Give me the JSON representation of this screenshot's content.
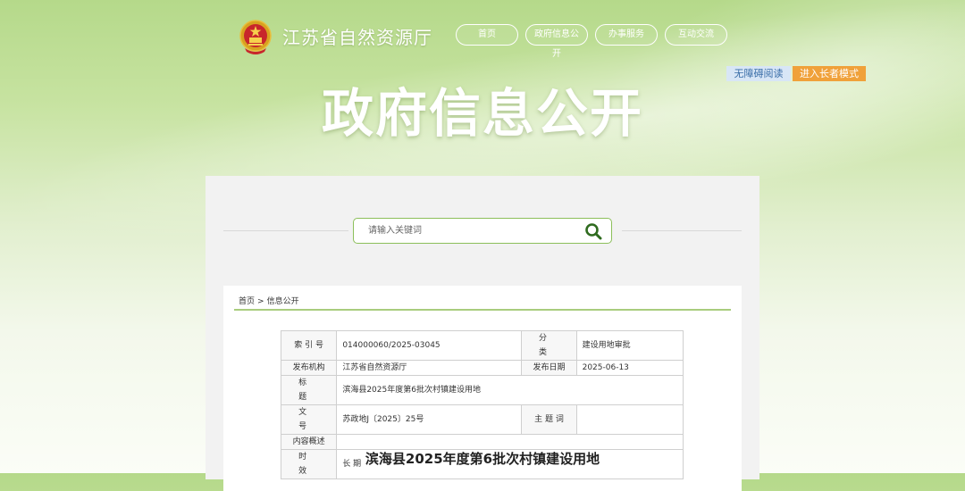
{
  "header": {
    "site_title": "江苏省自然资源厅",
    "nav": [
      "首页",
      "政府信息公开",
      "办事服务",
      "互动交流"
    ],
    "accessibility_label": "无障碍阅读",
    "elder_mode_label": "进入长者模式",
    "hero_title": "政府信息公开"
  },
  "search": {
    "placeholder": "请输入关键词"
  },
  "breadcrumb": {
    "items": [
      "首页",
      "信息公开"
    ],
    "separator": ">"
  },
  "info_table": {
    "index_no_label": "索 引 号",
    "index_no": "014000060/2025-03045",
    "category_label": "分 类",
    "category": "建设用地审批",
    "publisher_label": "发布机构",
    "publisher": "江苏省自然资源厅",
    "publish_date_label": "发布日期",
    "publish_date": "2025-06-13",
    "title_label": "标 题",
    "title": "滨海县2025年度第6批次村镇建设用地",
    "doc_no_label": "文 号",
    "doc_no": "苏政地J〔2025〕25号",
    "keywords_label": "主 题 词",
    "keywords": "",
    "summary_label": "内容概述",
    "summary": "",
    "validity_label": "时 效",
    "validity": "长 期"
  },
  "document": {
    "title": "滨海县2025年度第6批次村镇建设用地"
  },
  "colors": {
    "accent_green": "#8cbf5a",
    "elder_orange": "#f0a13a",
    "access_blue": "#d8e6f6"
  }
}
